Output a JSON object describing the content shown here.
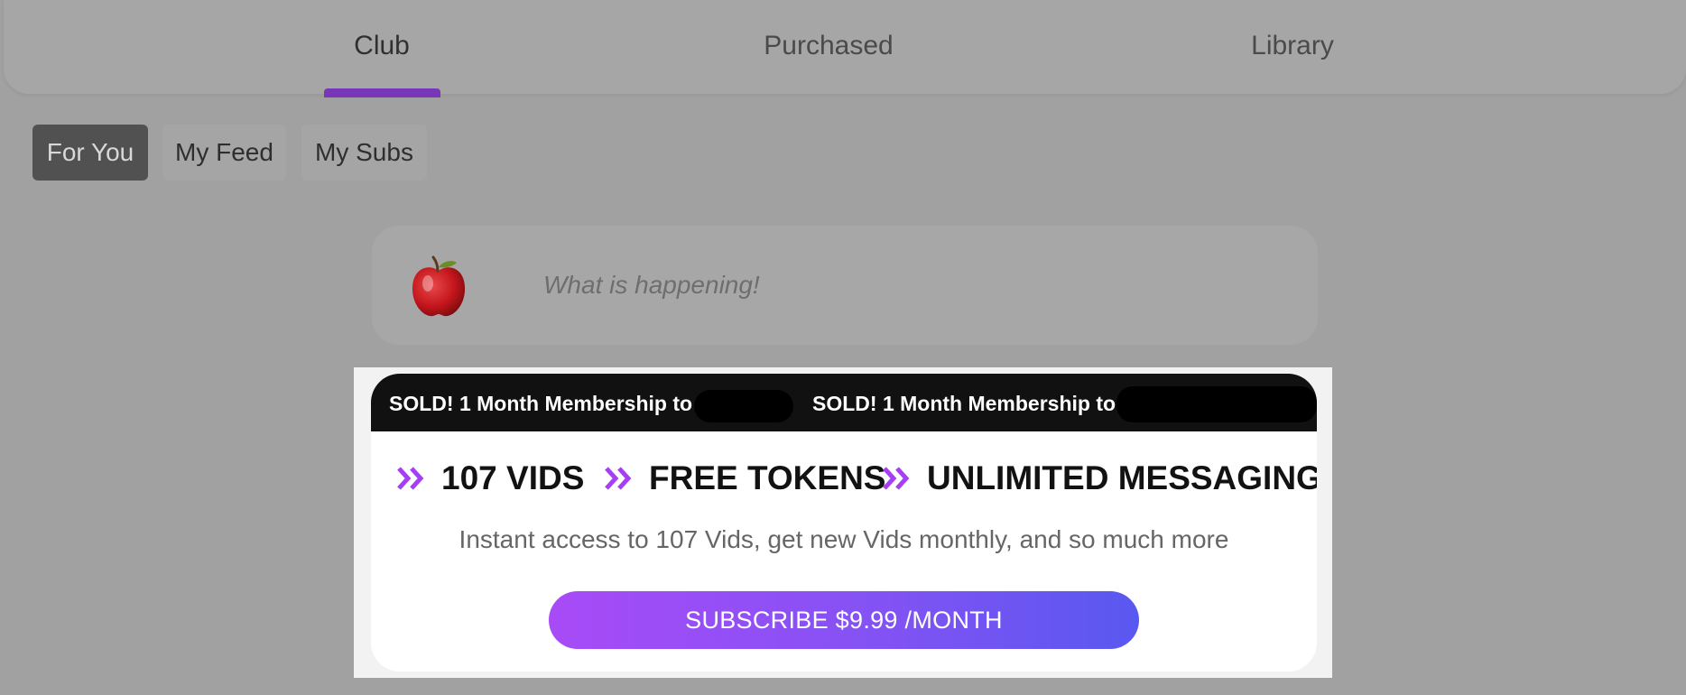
{
  "tabs": [
    {
      "label": "Club",
      "active": true
    },
    {
      "label": "Purchased",
      "active": false
    },
    {
      "label": "Library",
      "active": false
    }
  ],
  "filters": [
    {
      "label": "For You",
      "active": true
    },
    {
      "label": "My Feed",
      "active": false
    },
    {
      "label": "My Subs",
      "active": false
    }
  ],
  "composer": {
    "avatar_icon": "apple-icon",
    "placeholder": "What is happening!"
  },
  "promo": {
    "ticker": [
      "SOLD! 1 Month Membership to",
      "SOLD! 1 Month Membership to"
    ],
    "features": [
      "107 VIDS",
      "FREE TOKENS",
      "UNLIMITED MESSAGING"
    ],
    "description": "Instant access to 107 Vids, get new Vids monthly, and so much more",
    "button_label": "SUBSCRIBE $9.99 /MONTH"
  },
  "colors": {
    "accent_purple": "#7a36b8",
    "chevron": "#a43ff5",
    "button_start": "#a84bf7",
    "button_end": "#5858f0"
  }
}
